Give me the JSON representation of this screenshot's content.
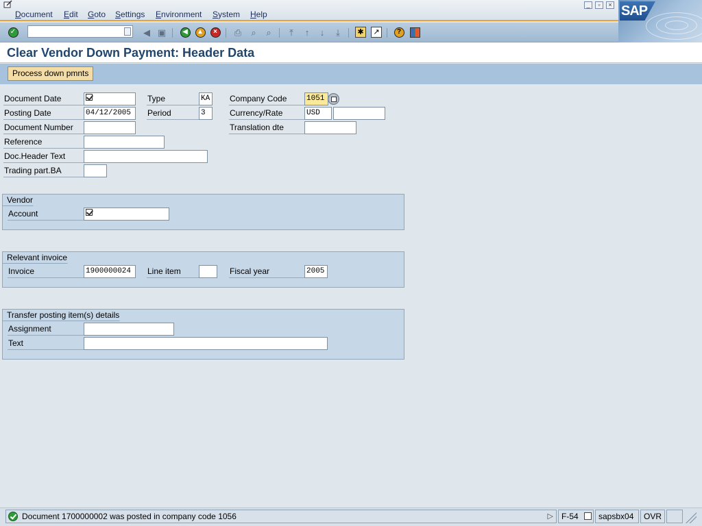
{
  "menu": [
    "Document",
    "Edit",
    "Goto",
    "Settings",
    "Environment",
    "System",
    "Help"
  ],
  "logo_text": "SAP",
  "command_field": {
    "value": ""
  },
  "title": "Clear Vendor Down Payment: Header Data",
  "app_toolbar": {
    "process_label": "Process down pmnts"
  },
  "header": {
    "document_date": {
      "label": "Document Date",
      "value": ""
    },
    "type": {
      "label": "Type",
      "value": "KA"
    },
    "company_code": {
      "label": "Company Code",
      "value": "1051"
    },
    "posting_date": {
      "label": "Posting Date",
      "value": "04/12/2005"
    },
    "period": {
      "label": "Period",
      "value": "3"
    },
    "currency_rate": {
      "label": "Currency/Rate",
      "currency": "USD",
      "rate": ""
    },
    "document_number": {
      "label": "Document Number",
      "value": ""
    },
    "translation_date": {
      "label": "Translation dte",
      "value": ""
    },
    "reference": {
      "label": "Reference",
      "value": ""
    },
    "doc_header_text": {
      "label": "Doc.Header Text",
      "value": ""
    },
    "trading_part_ba": {
      "label": "Trading part.BA",
      "value": ""
    }
  },
  "vendor": {
    "title": "Vendor",
    "account": {
      "label": "Account",
      "value": ""
    }
  },
  "relevant_invoice": {
    "title": "Relevant invoice",
    "invoice": {
      "label": "Invoice",
      "value": "1900000024"
    },
    "line_item": {
      "label": "Line item",
      "value": ""
    },
    "fiscal_year": {
      "label": "Fiscal year",
      "value": "2005"
    }
  },
  "transfer": {
    "title": "Transfer posting item(s) details",
    "assignment": {
      "label": "Assignment",
      "value": ""
    },
    "text": {
      "label": "Text",
      "value": ""
    }
  },
  "status": {
    "message": "Document 1700000002 was posted in company code 1056",
    "message_type": "success",
    "transaction": "F-54",
    "server": "sapsbx04",
    "mode": "OVR"
  },
  "icons": {
    "toolbar": [
      "enter-icon",
      "back-icon",
      "save-icon",
      "back-green-icon",
      "exit-icon",
      "cancel-icon",
      "print-icon",
      "find-icon",
      "find-next-icon",
      "first-page-icon",
      "prev-page-icon",
      "next-page-icon",
      "last-page-icon",
      "new-session-icon",
      "shortcut-icon",
      "help-icon",
      "layout-icon"
    ]
  },
  "colors": {
    "title": "#1f466e",
    "process_button": "#f4dca6",
    "required_field": "#fbe99a",
    "group_bg": "#c6d7e7",
    "success": "#2e9a3b"
  }
}
